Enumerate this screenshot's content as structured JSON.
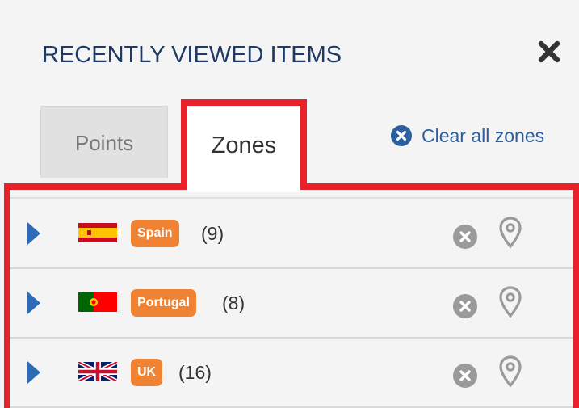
{
  "header": {
    "title": "RECENTLY VIEWED ITEMS"
  },
  "tabs": [
    {
      "label": "Points"
    },
    {
      "label": "Zones"
    }
  ],
  "actions": {
    "clear_all_label": "Clear all zones"
  },
  "zones": [
    {
      "name": "Spain",
      "count": "(9)",
      "flag": "spain-flag-icon"
    },
    {
      "name": "Portugal",
      "count": "(8)",
      "flag": "portugal-flag-icon"
    },
    {
      "name": "UK",
      "count": "(16)",
      "flag": "uk-flag-icon"
    }
  ],
  "colors": {
    "accent": "#f08233",
    "title": "#1f3a64",
    "link": "#2d5f9e",
    "highlight": "#e8212b",
    "arrow": "#2e6bb5"
  }
}
